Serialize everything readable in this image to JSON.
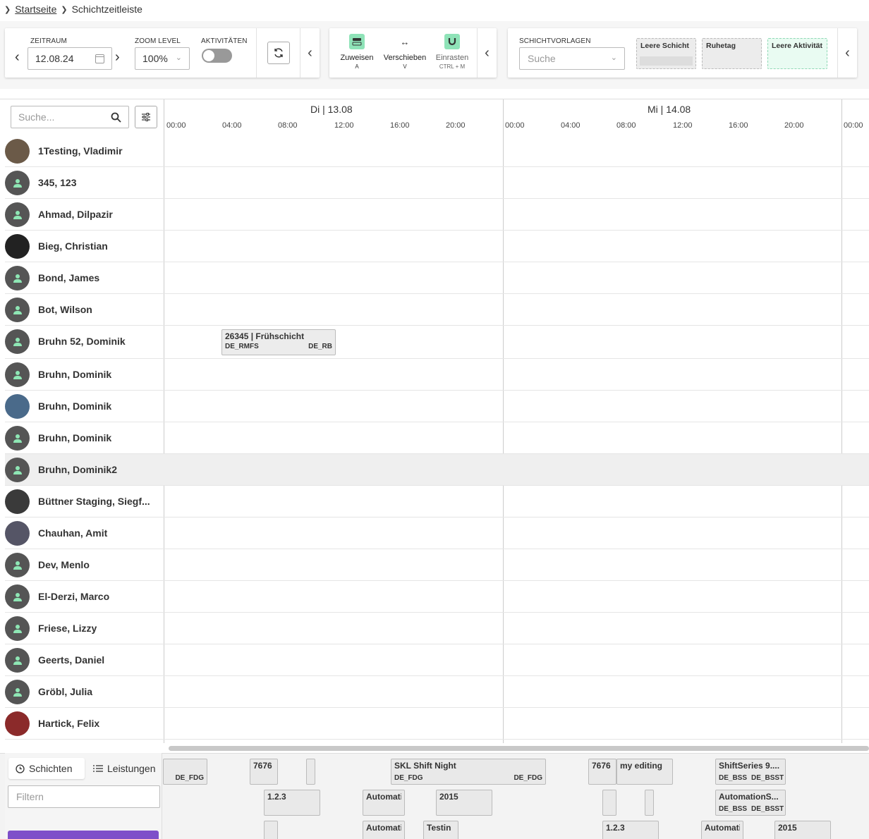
{
  "breadcrumb": {
    "home": "Startseite",
    "current": "Schichtzeitleiste"
  },
  "toolbar": {
    "zeitraum_label": "ZEITRAUM",
    "date_value": "12.08.24",
    "zoom_label": "ZOOM LEVEL",
    "zoom_value": "100%",
    "aktivitaeten_label": "AKTIVITÄTEN",
    "aktivitaeten_on": false
  },
  "tools": [
    {
      "label": "Zuweisen",
      "key": "A",
      "icon": "assign-icon"
    },
    {
      "label": "Verschieben",
      "key": "V",
      "icon": "move-arrows-icon"
    },
    {
      "label": "Einrasten",
      "key": "CTRL + M",
      "icon": "magnet-icon"
    }
  ],
  "vorlagen": {
    "label": "SCHICHTVORLAGEN",
    "search_placeholder": "Suche",
    "templates": [
      "Leere Schicht",
      "Ruhetag",
      "Leere Aktivität"
    ]
  },
  "grid": {
    "search_placeholder": "Suche...",
    "days": [
      "Di | 13.08",
      "Mi | 14.08"
    ],
    "hours": [
      "00:00",
      "04:00",
      "08:00",
      "12:00",
      "16:00",
      "20:00",
      "00:00",
      "04:00",
      "08:00",
      "12:00",
      "16:00",
      "20:00",
      "00:00"
    ]
  },
  "employees": [
    {
      "name": "1Testing, Vladimir",
      "photo": true
    },
    {
      "name": "345, 123",
      "photo": false
    },
    {
      "name": "Ahmad, Dilpazir",
      "photo": false
    },
    {
      "name": "Bieg, Christian",
      "photo": true
    },
    {
      "name": "Bond, James",
      "photo": false
    },
    {
      "name": "Bot, Wilson",
      "photo": false
    },
    {
      "name": "Bruhn 52, Dominik",
      "photo": false
    },
    {
      "name": "Bruhn, Dominik",
      "photo": false
    },
    {
      "name": "Bruhn, Dominik",
      "photo": true
    },
    {
      "name": "Bruhn, Dominik",
      "photo": false
    },
    {
      "name": "Bruhn, Dominik2",
      "photo": false
    },
    {
      "name": "Büttner Staging, Siegf...",
      "photo": true
    },
    {
      "name": "Chauhan, Amit",
      "photo": true
    },
    {
      "name": "Dev, Menlo",
      "photo": false
    },
    {
      "name": "El-Derzi, Marco",
      "photo": false
    },
    {
      "name": "Friese, Lizzy",
      "photo": false
    },
    {
      "name": "Geerts, Daniel",
      "photo": false
    },
    {
      "name": "Gröbl, Julia",
      "photo": false
    },
    {
      "name": "Hartick, Felix",
      "photo": true
    }
  ],
  "shift": {
    "title": "26345 | Frühschicht",
    "left_code": "DE_RMFS",
    "right_code": "DE_RB"
  },
  "bottom": {
    "tab_schichten": "Schichten",
    "tab_leistungen": "Leistungen",
    "filter_placeholder": "Filtern",
    "pool": [
      {
        "title": "",
        "codes": [
          "",
          "DE_FDG"
        ]
      },
      {
        "title": "7676",
        "codes": []
      },
      {
        "title": "",
        "codes": []
      },
      {
        "title": "SKL Shift Night",
        "codes": [
          "DE_FDG",
          "DE_FDG"
        ]
      },
      {
        "title": "7676",
        "codes": []
      },
      {
        "title": "my editing",
        "codes": []
      },
      {
        "title": "ShiftSeries 9....",
        "codes": [
          "DE_BSS",
          "DE_BSST"
        ]
      },
      {
        "title": "1.2.3",
        "codes": []
      },
      {
        "title": "Automatic",
        "codes": []
      },
      {
        "title": "2015",
        "codes": []
      },
      {
        "title": "",
        "codes": []
      },
      {
        "title": "",
        "codes": []
      },
      {
        "title": "AutomationS...",
        "codes": [
          "DE_BSS",
          "DE_BSST"
        ]
      },
      {
        "title": "",
        "codes": []
      },
      {
        "title": "Automatic",
        "codes": []
      },
      {
        "title": "Testin",
        "codes": []
      },
      {
        "title": "1.2.3",
        "codes": []
      },
      {
        "title": "Automatic",
        "codes": []
      },
      {
        "title": "2015",
        "codes": []
      }
    ]
  }
}
